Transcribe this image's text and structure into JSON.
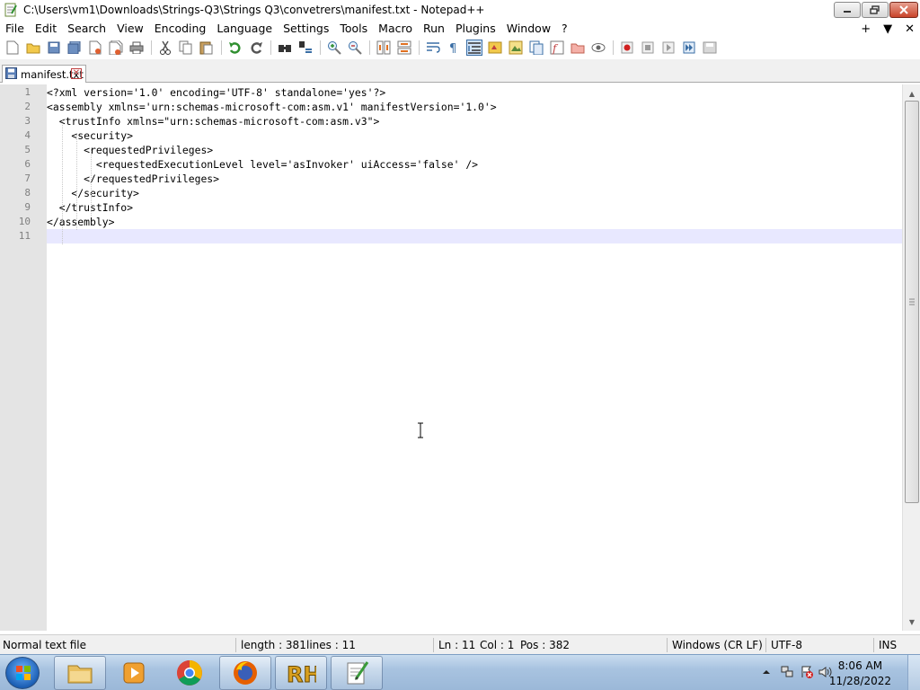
{
  "window": {
    "title": "C:\\Users\\vm1\\Downloads\\Strings-Q3\\Strings Q3\\convetrers\\manifest.txt - Notepad++"
  },
  "menu": {
    "items": [
      "File",
      "Edit",
      "Search",
      "View",
      "Encoding",
      "Language",
      "Settings",
      "Tools",
      "Macro",
      "Run",
      "Plugins",
      "Window",
      "?"
    ],
    "right": [
      "+",
      "▼",
      "✕"
    ]
  },
  "toolbar": {
    "icons": [
      "new-file-icon",
      "open-file-icon",
      "save-icon",
      "save-all-icon",
      "close-icon",
      "close-all-icon",
      "print-icon",
      "cut-icon",
      "copy-icon",
      "paste-icon",
      "undo-icon",
      "redo-icon",
      "find-icon",
      "replace-icon",
      "zoom-in-icon",
      "zoom-out-icon",
      "sync-vertical-icon",
      "sync-horizontal-icon",
      "word-wrap-icon",
      "show-all-characters-icon",
      "indent-guide-icon",
      "user-defined-language-icon",
      "document-map-icon",
      "document-list-icon",
      "function-list-icon",
      "folder-as-workspace-icon",
      "monitoring-icon",
      "record-macro-icon",
      "stop-recording-icon",
      "play-macro-icon",
      "run-macro-multiple-icon",
      "save-macro-icon"
    ]
  },
  "tab": {
    "label": "manifest.txt",
    "close": "✕"
  },
  "editor": {
    "line_numbers": [
      "1",
      "2",
      "3",
      "4",
      "5",
      "6",
      "7",
      "8",
      "9",
      "10",
      "11"
    ],
    "lines": [
      "<?xml version='1.0' encoding='UTF-8' standalone='yes'?>",
      "<assembly xmlns='urn:schemas-microsoft-com:asm.v1' manifestVersion='1.0'>",
      "  <trustInfo xmlns=\"urn:schemas-microsoft-com:asm.v3\">",
      "    <security>",
      "      <requestedPrivileges>",
      "        <requestedExecutionLevel level='asInvoker' uiAccess='false' />",
      "      </requestedPrivileges>",
      "    </security>",
      "  </trustInfo>",
      "</assembly>",
      ""
    ],
    "current_line": 11
  },
  "status": {
    "file_type": "Normal text file",
    "length": "length : 381",
    "lines": "lines : 11",
    "ln": "Ln : 11",
    "col": "Col : 1",
    "pos": "Pos : 382",
    "eol": "Windows (CR LF)",
    "encoding": "UTF-8",
    "mode": "INS"
  },
  "taskbar": {
    "apps": [
      "file-explorer-icon",
      "media-player-icon",
      "chrome-icon",
      "firefox-icon",
      "rh-app-icon",
      "notepad-plus-plus-icon"
    ],
    "rh_label": "RH",
    "time": "8:06 AM",
    "date": "11/28/2022"
  }
}
